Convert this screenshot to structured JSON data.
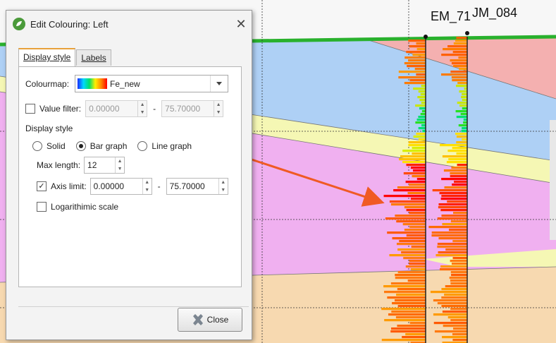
{
  "dialog": {
    "title": "Edit Colouring: Left",
    "close_icon": "close-icon",
    "tabs": [
      {
        "label": "Display style",
        "active": true
      },
      {
        "label": "Labels",
        "active": false
      }
    ],
    "colourmap": {
      "label": "Colourmap:",
      "value": "Fe_new"
    },
    "value_filter": {
      "label": "Value filter:",
      "checked": false,
      "min": "0.00000",
      "separator": "-",
      "max": "75.70000"
    },
    "display_style": {
      "heading": "Display style",
      "options": [
        {
          "label": "Solid",
          "selected": false
        },
        {
          "label": "Bar graph",
          "selected": true
        },
        {
          "label": "Line graph",
          "selected": false
        }
      ]
    },
    "max_length": {
      "label": "Max length:",
      "value": "12"
    },
    "axis_limit": {
      "label": "Axis limit:",
      "checked": true,
      "min": "0.00000",
      "separator": "-",
      "max": "75.70000"
    },
    "log_scale": {
      "label": "Logarithimic scale",
      "checked": false
    },
    "close_button": "Close"
  },
  "scene": {
    "well_labels": [
      "EM_71",
      "JM_084"
    ],
    "colors": {
      "arrow": "#f05a24",
      "surface": "#29b12d",
      "blue_layer": "#aed0f5",
      "pink_layer": "#f0b0f0",
      "yellow_band": "#f5f7b4",
      "red_layer": "#f4b0b0"
    }
  }
}
